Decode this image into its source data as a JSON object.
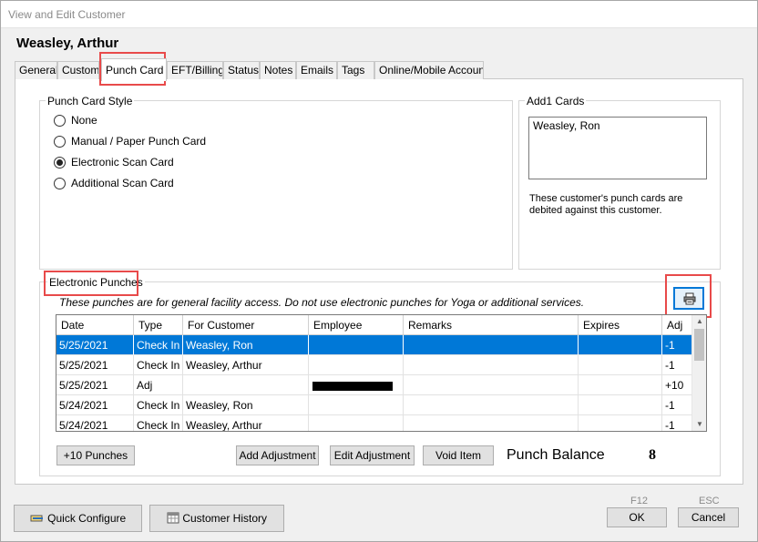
{
  "window": {
    "title": "View and Edit Customer"
  },
  "customer": {
    "name": "Weasley, Arthur"
  },
  "tabs": [
    {
      "label": "General"
    },
    {
      "label": "Custom"
    },
    {
      "label": "Punch Card"
    },
    {
      "label": "EFT/Billing"
    },
    {
      "label": "Status"
    },
    {
      "label": "Notes"
    },
    {
      "label": "Emails"
    },
    {
      "label": "Tags"
    },
    {
      "label": "Online/Mobile Account"
    }
  ],
  "punch_card_style": {
    "label": "Punch Card Style",
    "options": [
      {
        "label": "None",
        "checked": false
      },
      {
        "label": "Manual / Paper Punch Card",
        "checked": false
      },
      {
        "label": "Electronic Scan Card",
        "checked": true
      },
      {
        "label": "Additional Scan Card",
        "checked": false
      }
    ]
  },
  "add1_cards": {
    "label": "Add1 Cards",
    "items": [
      "Weasley, Ron"
    ],
    "note": "These customer's punch cards are debited against this customer."
  },
  "electronic_punches": {
    "label": "Electronic Punches",
    "notice": "These punches are for general facility access.  Do not use electronic punches for Yoga or additional services.",
    "columns": [
      "Date",
      "Type",
      "For Customer",
      "Employee",
      "Remarks",
      "Expires",
      "Adj"
    ],
    "rows": [
      {
        "date": "5/25/2021",
        "type": "Check In",
        "customer": "Weasley, Ron",
        "employee": "",
        "remarks": "",
        "expires": "",
        "adj": "-1",
        "selected": true
      },
      {
        "date": "5/25/2021",
        "type": "Check In",
        "customer": "Weasley, Arthur",
        "employee": "",
        "remarks": "",
        "expires": "",
        "adj": "-1",
        "selected": false
      },
      {
        "date": "5/25/2021",
        "type": "Adj",
        "customer": "",
        "employee": "",
        "remarks": "",
        "expires": "",
        "adj": "+10",
        "selected": false,
        "employee_redacted": true
      },
      {
        "date": "5/24/2021",
        "type": "Check In",
        "customer": "Weasley, Ron",
        "employee": "",
        "remarks": "",
        "expires": "",
        "adj": "-1",
        "selected": false
      },
      {
        "date": "5/24/2021",
        "type": "Check In",
        "customer": "Weasley, Arthur",
        "employee": "",
        "remarks": "",
        "expires": "",
        "adj": "-1",
        "selected": false
      }
    ],
    "buttons": {
      "add_ten": "+10 Punches",
      "add_adjustment": "Add Adjustment",
      "edit_adjustment": "Edit Adjustment",
      "void_item": "Void Item"
    },
    "balance_label": "Punch Balance",
    "balance_value": "8",
    "print_icon": "printer-icon"
  },
  "footer": {
    "quick_configure": "Quick Configure",
    "customer_history": "Customer History",
    "ok": "OK",
    "ok_key": "F12",
    "cancel": "Cancel",
    "cancel_key": "ESC"
  },
  "colors": {
    "selection": "#0078d7",
    "highlight": "#e84a4a"
  }
}
